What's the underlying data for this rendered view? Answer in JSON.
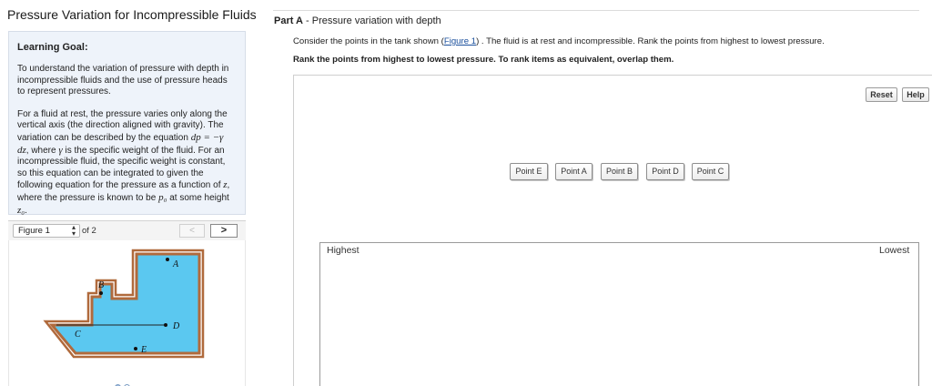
{
  "page_title": "Pressure Variation for Incompressible Fluids",
  "learning_goal": {
    "heading": "Learning Goal:",
    "para1": "To understand the variation of pressure with depth in incompressible fluids and the use of pressure heads to represent pressures.",
    "para2_a": "For a fluid at rest, the pressure varies only along the vertical axis (the direction aligned with gravity). The variation can be described by the equation ",
    "para2_eq": "dp = −γ dz",
    "para2_b": ", where ",
    "para2_gamma": "γ",
    "para2_c": " is the specific weight of the fluid. For an incompressible fluid, the specific weight is constant, so this equation can be integrated to given the following equation for the pressure as a function of ",
    "para2_z": "z",
    "para2_d": ", where the pressure is known to be ",
    "para2_p0": "p₀",
    "para2_e": " at some height ",
    "para2_z0": "z₀",
    "para2_f": "."
  },
  "figure_nav": {
    "selected": "Figure 1",
    "of_label": "of 2",
    "prev_glyph": "<",
    "next_glyph": ">"
  },
  "figure": {
    "labels": [
      "A",
      "B",
      "C",
      "D",
      "E"
    ],
    "fluid_color": "#5bc8f0",
    "wall_color": "#b06a3c"
  },
  "part": {
    "label": "Part A",
    "separator": " - ",
    "title": "Pressure variation with depth"
  },
  "prompt": {
    "before_link": "Consider the points in the tank shown (",
    "link_text": "Figure 1",
    "after_link": ") . The fluid is at rest and incompressible. Rank the points from highest to lowest pressure.",
    "instruction": "Rank the points from highest to lowest pressure. To rank items as equivalent, overlap them."
  },
  "buttons": {
    "reset": "Reset",
    "help": "Help"
  },
  "chips": [
    "Point E",
    "Point A",
    "Point B",
    "Point D",
    "Point C"
  ],
  "ranking": {
    "high_label": "Highest",
    "low_label": "Lowest"
  }
}
